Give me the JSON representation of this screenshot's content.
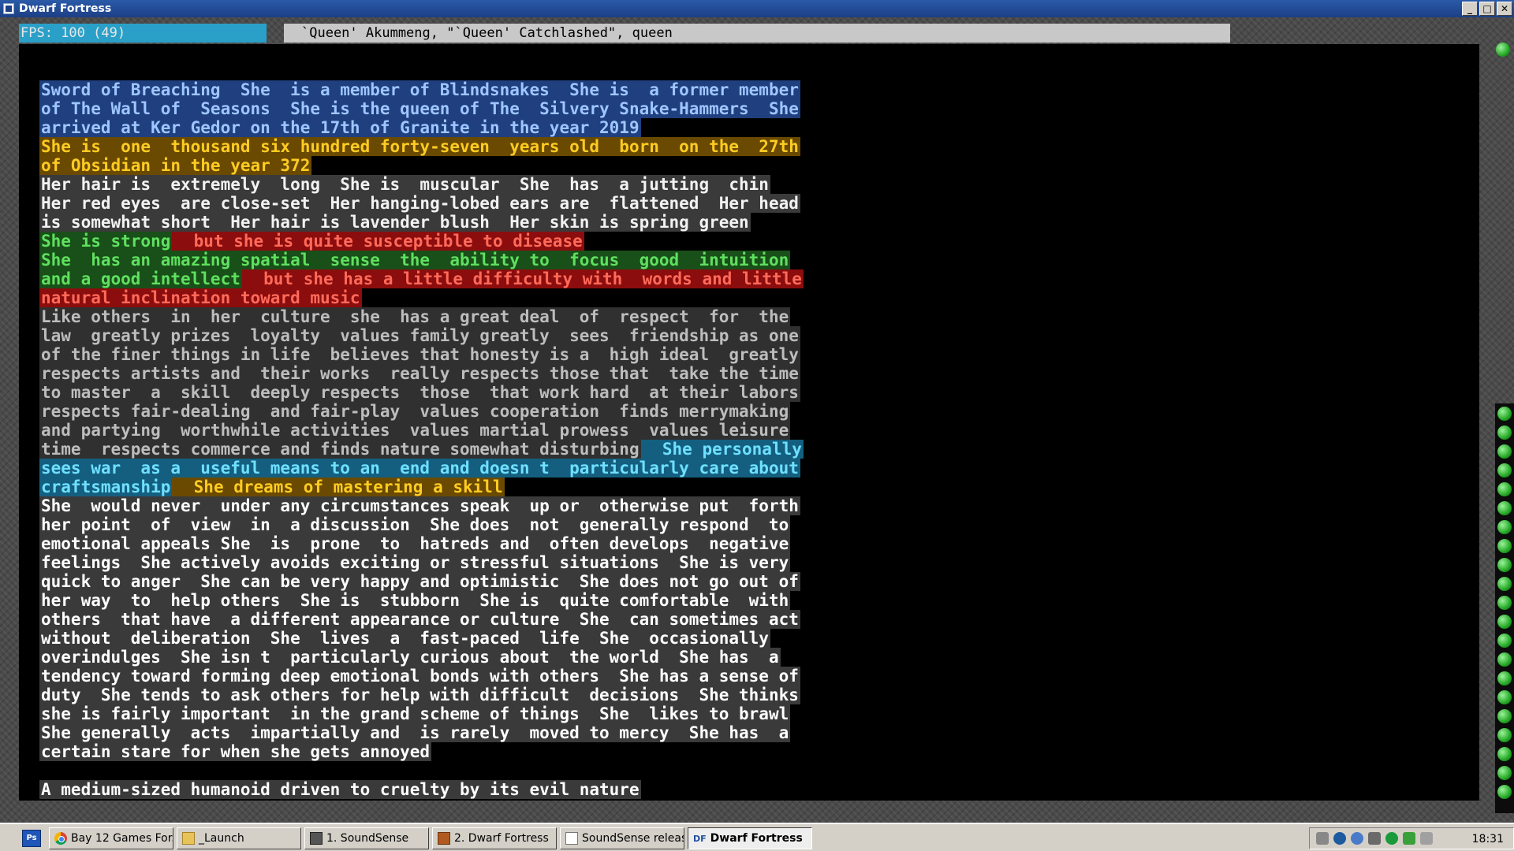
{
  "window": {
    "title": "Dwarf Fortress",
    "minimize": "_",
    "maximize": "□",
    "close": "✕"
  },
  "hud": {
    "fps": "FPS: 100 (49)",
    "header": "`Queen' Akummeng, \"`Queen' Catchlashed\", queen"
  },
  "description_lines": [
    [
      {
        "c": "blue",
        "t": "Sword of Breaching  She  is a member of Blindsnakes  She is  a former member"
      }
    ],
    [
      {
        "c": "blue",
        "t": "of The Wall of  Seasons  She is the queen of The  Silvery Snake-Hammers  She"
      }
    ],
    [
      {
        "c": "blue",
        "t": "arrived at Ker Gedor on the 17th of Granite in the year 2019"
      }
    ],
    [
      {
        "c": "orange",
        "t": "She is  one  thousand six hundred forty-seven  years old  born  on the  27th"
      }
    ],
    [
      {
        "c": "orange",
        "t": "of Obsidian in the year 372"
      }
    ],
    [
      {
        "c": "white",
        "t": "Her hair is  extremely  long  She is  muscular  She  has  a jutting  chin"
      }
    ],
    [
      {
        "c": "white",
        "t": "Her red eyes  are close-set  Her hanging-lobed ears are  flattened  Her head"
      }
    ],
    [
      {
        "c": "white",
        "t": "is somewhat short  Her hair is lavender blush  Her skin is spring green"
      }
    ],
    [
      {
        "c": "green",
        "t": "She is strong"
      },
      {
        "c": "red",
        "t": "  but she is quite susceptible to disease"
      }
    ],
    [
      {
        "c": "green",
        "t": "She  has an amazing spatial  sense  the  ability to  focus  good  intuition"
      }
    ],
    [
      {
        "c": "green",
        "t": "and a good intellect"
      },
      {
        "c": "red",
        "t": "  but she has a little difficulty with  words and little"
      }
    ],
    [
      {
        "c": "red",
        "t": "natural inclination toward music"
      }
    ],
    [
      {
        "c": "gray",
        "t": "Like others  in  her  culture  she  has a great deal  of  respect  for  the"
      }
    ],
    [
      {
        "c": "gray",
        "t": "law  greatly prizes  loyalty  values family greatly  sees  friendship as one"
      }
    ],
    [
      {
        "c": "gray",
        "t": "of the finer things in life  believes that honesty is a  high ideal  greatly"
      }
    ],
    [
      {
        "c": "gray",
        "t": "respects artists and  their works  really respects those that  take the time"
      }
    ],
    [
      {
        "c": "gray",
        "t": "to master  a  skill  deeply respects  those  that work hard  at their labors"
      }
    ],
    [
      {
        "c": "gray",
        "t": "respects fair-dealing  and fair-play  values cooperation  finds merrymaking"
      }
    ],
    [
      {
        "c": "gray",
        "t": "and partying  worthwhile activities  values martial prowess  values leisure"
      }
    ],
    [
      {
        "c": "gray",
        "t": "time  respects commerce and finds nature somewhat disturbing"
      },
      {
        "c": "cyan",
        "t": "  She personally"
      }
    ],
    [
      {
        "c": "cyan",
        "t": "sees war  as a  useful means to an  end and doesn t  particularly care about"
      }
    ],
    [
      {
        "c": "cyan",
        "t": "craftsmanship"
      },
      {
        "c": "orange",
        "t": "  She dreams of mastering a skill"
      }
    ],
    [
      {
        "c": "plain",
        "t": "She  would never  under any circumstances speak  up or  otherwise put  forth"
      }
    ],
    [
      {
        "c": "plain",
        "t": "her point  of  view  in  a discussion  She does  not  generally respond  to"
      }
    ],
    [
      {
        "c": "plain",
        "t": "emotional appeals She  is  prone  to  hatreds and  often develops  negative"
      }
    ],
    [
      {
        "c": "plain",
        "t": "feelings  She actively avoids exciting or stressful situations  She is very"
      }
    ],
    [
      {
        "c": "plain",
        "t": "quick to anger  She can be very happy and optimistic  She does not go out of"
      }
    ],
    [
      {
        "c": "plain",
        "t": "her way  to  help others  She is  stubborn  She is  quite comfortable  with"
      }
    ],
    [
      {
        "c": "plain",
        "t": "others  that have  a different appearance or culture  She  can sometimes act"
      }
    ],
    [
      {
        "c": "plain",
        "t": "without  deliberation  She  lives  a  fast-paced  life  She  occasionally"
      }
    ],
    [
      {
        "c": "plain",
        "t": "overindulges  She isn t  particularly curious about  the world  She has  a"
      }
    ],
    [
      {
        "c": "plain",
        "t": "tendency toward forming deep emotional bonds with others  She has a sense of"
      }
    ],
    [
      {
        "c": "plain",
        "t": "duty  She tends to ask others for help with difficult  decisions  She thinks"
      }
    ],
    [
      {
        "c": "plain",
        "t": "she is fairly important  in the grand scheme of things  She  likes to brawl"
      }
    ],
    [
      {
        "c": "plain",
        "t": "She generally  acts  impartially and  is rarely  moved to mercy  She has  a"
      }
    ],
    [
      {
        "c": "plain",
        "t": "certain stare for when she gets annoyed"
      }
    ],
    [],
    [
      {
        "c": "plain",
        "t": "A medium-sized humanoid driven to cruelty by its evil nature"
      }
    ]
  ],
  "taskbar": {
    "items": [
      {
        "label": "Bay 12 Games For...",
        "icon": "chrome-icon"
      },
      {
        "label": "_Launch",
        "icon": "folder-icon"
      },
      {
        "label": "1. SoundSense",
        "icon": "terminal-icon"
      },
      {
        "label": "2. Dwarf Fortress",
        "icon": "dwarf-fortress-icon"
      },
      {
        "label": "SoundSense releas...",
        "icon": "document-icon"
      },
      {
        "label": "Dwarf Fortress",
        "icon": "df-text-icon",
        "badge": "DF"
      }
    ],
    "clock": "18:31"
  }
}
